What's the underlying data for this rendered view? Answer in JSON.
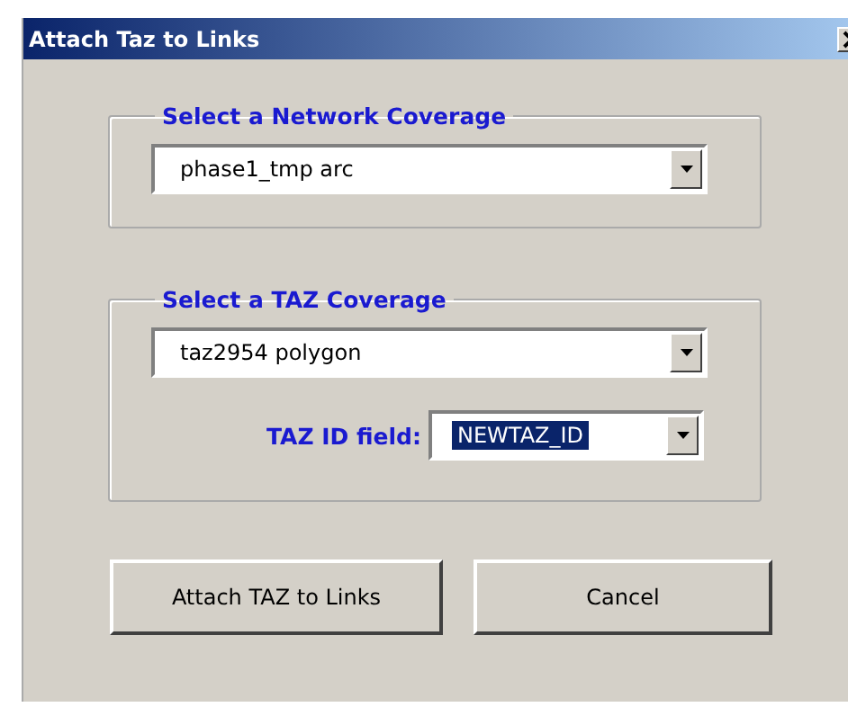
{
  "window": {
    "title": "Attach Taz to Links"
  },
  "groups": [
    {
      "legend": "Select a Network Coverage",
      "combo": {
        "value": "phase1_tmp arc"
      }
    },
    {
      "legend": "Select a TAZ Coverage",
      "combo": {
        "value": "taz2954 polygon"
      },
      "field": {
        "label": "TAZ ID field:",
        "value": "NEWTAZ_ID",
        "text_selected": true
      }
    }
  ],
  "buttons": [
    "Attach TAZ to Links",
    "Cancel"
  ]
}
